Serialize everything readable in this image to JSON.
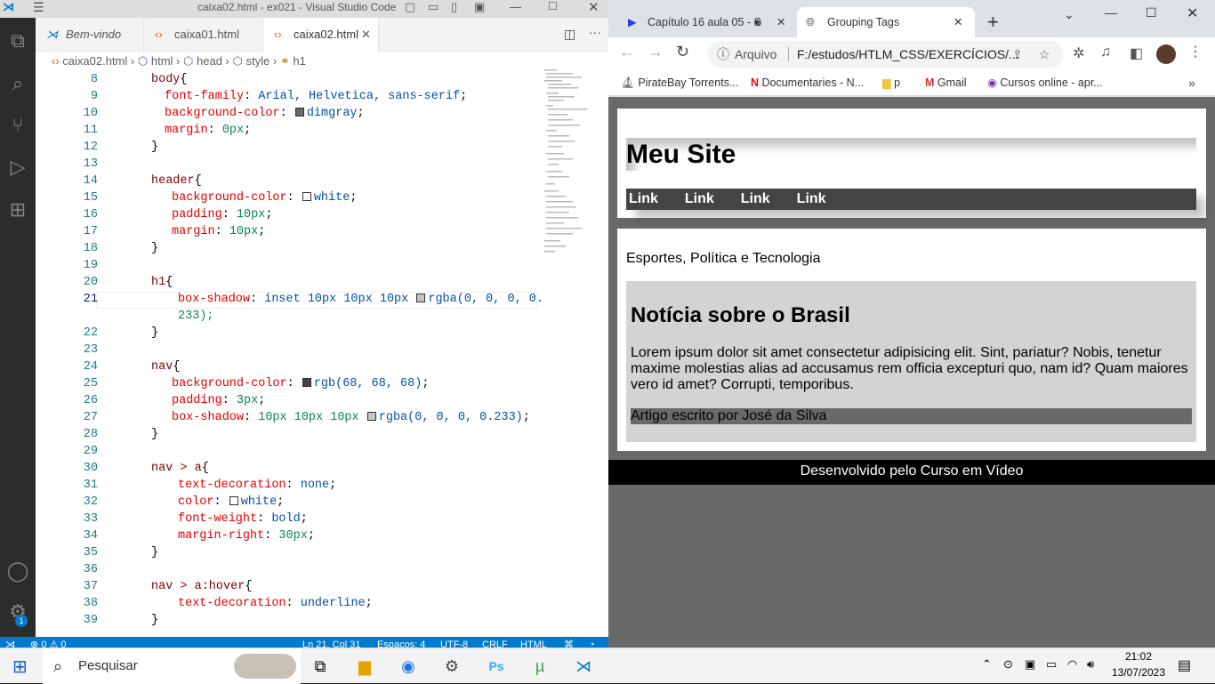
{
  "vscode": {
    "window_title": "caixa02.html - ex021 - Visual Studio Code",
    "tabs": [
      {
        "label": "Bem-vindo",
        "icon": "vscode-icon"
      },
      {
        "label": "caixa01.html",
        "icon": "html-icon"
      },
      {
        "label": "caixa02.html",
        "icon": "html-icon",
        "active": true
      }
    ],
    "breadcrumb": [
      "caixa02.html",
      "html",
      "head",
      "style",
      "h1"
    ],
    "lines": [
      {
        "n": "8"
      },
      {
        "n": "9"
      },
      {
        "n": "10"
      },
      {
        "n": "11"
      },
      {
        "n": "12"
      },
      {
        "n": "13"
      },
      {
        "n": "14"
      },
      {
        "n": "15"
      },
      {
        "n": "16"
      },
      {
        "n": "17"
      },
      {
        "n": "18"
      },
      {
        "n": "19"
      },
      {
        "n": "20"
      },
      {
        "n": "21"
      },
      {
        "n": ""
      },
      {
        "n": "22"
      },
      {
        "n": "23"
      },
      {
        "n": "24"
      },
      {
        "n": "25"
      },
      {
        "n": "26"
      },
      {
        "n": "27"
      },
      {
        "n": "28"
      },
      {
        "n": "29"
      },
      {
        "n": "30"
      },
      {
        "n": "31"
      },
      {
        "n": "32"
      },
      {
        "n": "33"
      },
      {
        "n": "34"
      },
      {
        "n": "35"
      },
      {
        "n": "36"
      },
      {
        "n": "37"
      },
      {
        "n": "38"
      },
      {
        "n": "39"
      }
    ],
    "code": {
      "l8_sel": "body",
      "l8_brace": "{",
      "l9_prop": "font-family",
      "l9_val": "Arial, Helvetica, sans-serif",
      "l10_prop": "background-color",
      "l10_val": "dimgray",
      "l11_prop": "margin",
      "l11_val": "0px",
      "l12": "}",
      "l14_sel": "header",
      "l14_brace": "{",
      "l15_prop": "background-color",
      "l15_val": "white",
      "l16_prop": "padding",
      "l16_val": "10px",
      "l17_prop": "margin",
      "l17_val": "10px",
      "l18": "}",
      "l20_sel": "h1",
      "l20_brace": "{",
      "l21_prop": "box-shadow",
      "l21_val": "inset 10px 10px 10px",
      "l21_rgba": "rgba(0, 0, 0, 0.",
      "l21b": "233);",
      "l22": "}",
      "l24_sel": "nav",
      "l24_brace": "{",
      "l25_prop": "background-color",
      "l25_val": "rgb(68, 68, 68)",
      "l26_prop": "padding",
      "l26_val": "3px",
      "l27_prop": "box-shadow",
      "l27_val": "10px 10px 10px",
      "l27_rgba": "rgba(0, 0, 0, 0.233)",
      "l28": "}",
      "l30_sel": "nav > a",
      "l30_brace": "{",
      "l31_prop": "text-decoration",
      "l31_val": "none",
      "l32_prop": "color",
      "l32_val": "white",
      "l33_prop": "font-weight",
      "l33_val": "bold",
      "l34_prop": "margin-right",
      "l34_val": "30px",
      "l35": "}",
      "l37_sel": "nav > a:hover",
      "l37_brace": "{",
      "l38_prop": "text-decoration",
      "l38_val": "underline",
      "l39": "}"
    },
    "status": {
      "errors": "⊗ 0 ⚠ 0",
      "position": "Ln 21, Col 31",
      "spaces": "Espaços: 4",
      "encoding": "UTF-8",
      "eol": "CRLF",
      "language": "HTML"
    },
    "badge": "1",
    "colors": {
      "accent": "#007acc",
      "swatch_dimgray": "#696969",
      "swatch_white": "#ffffff",
      "swatch_nav": "#444444",
      "swatch_rgba": "#c4c4c4"
    }
  },
  "chrome": {
    "tabs": [
      {
        "label": "Capítulo 16 aula 05 - S",
        "icon": "youtube-icon"
      },
      {
        "label": "Grouping Tags",
        "icon": "globe-icon"
      }
    ],
    "address_label": "Arquivo",
    "address": "F:/estudos/HTLM_CSS/EXERCÍCIOS/...",
    "bookmarks": [
      {
        "label": "PirateBay Torrents..."
      },
      {
        "label": "Documentaries - N..."
      },
      {
        "label": "p"
      },
      {
        "label": "Gmail"
      },
      {
        "label": "Cursos online - apr..."
      }
    ]
  },
  "site": {
    "title": "Meu Site",
    "nav": [
      "Link",
      "Link",
      "Link",
      "Link"
    ],
    "subtitle": "Esportes, Política e Tecnologia",
    "article_title": "Notícia sobre o Brasil",
    "article_text": "Lorem ipsum dolor sit amet consectetur adipisicing elit. Sint, pariatur? Nobis, tenetur maxime molestias alias ad accusamus rem officia excepturi quo, nam id? Quam maiores vero id amet? Corrupti, temporibus.",
    "article_author": "Artigo escrito por José da Silva",
    "footer": "Desenvolvido pelo Curso em Vídeo"
  },
  "taskbar": {
    "search_placeholder": "Pesquisar",
    "time": "21:02",
    "date": "13/07/2023"
  }
}
